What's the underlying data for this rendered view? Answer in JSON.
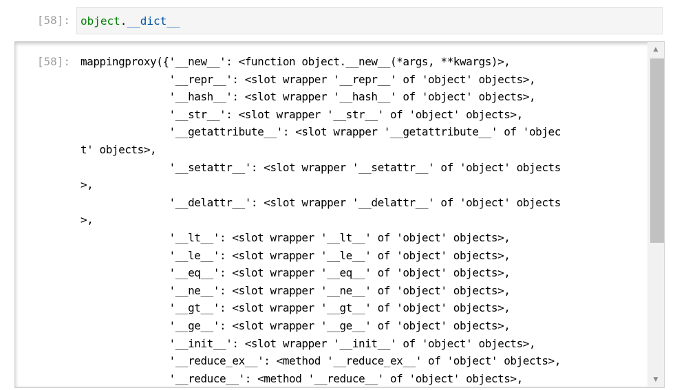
{
  "input_cell": {
    "prompt": "[58]:",
    "code_obj": "object",
    "code_dot": ".",
    "code_attr": "__dict__"
  },
  "output_cell": {
    "prompt": "[58]:",
    "lines": [
      "mappingproxy({'__new__': <function object.__new__(*args, **kwargs)>,",
      "              '__repr__': <slot wrapper '__repr__' of 'object' objects>,",
      "              '__hash__': <slot wrapper '__hash__' of 'object' objects>,",
      "              '__str__': <slot wrapper '__str__' of 'object' objects>,",
      "              '__getattribute__': <slot wrapper '__getattribute__' of 'objec",
      "t' objects>,",
      "              '__setattr__': <slot wrapper '__setattr__' of 'object' objects",
      ">,",
      "              '__delattr__': <slot wrapper '__delattr__' of 'object' objects",
      ">,",
      "              '__lt__': <slot wrapper '__lt__' of 'object' objects>,",
      "              '__le__': <slot wrapper '__le__' of 'object' objects>,",
      "              '__eq__': <slot wrapper '__eq__' of 'object' objects>,",
      "              '__ne__': <slot wrapper '__ne__' of 'object' objects>,",
      "              '__gt__': <slot wrapper '__gt__' of 'object' objects>,",
      "              '__ge__': <slot wrapper '__ge__' of 'object' objects>,",
      "              '__init__': <slot wrapper '__init__' of 'object' objects>,",
      "              '__reduce_ex__': <method '__reduce_ex__' of 'object' objects>,",
      "              '__reduce__': <method '__reduce__' of 'object' objects>,"
    ]
  },
  "scrollbar": {
    "up_icon": "triangle-up-icon",
    "down_icon": "triangle-down-icon"
  }
}
